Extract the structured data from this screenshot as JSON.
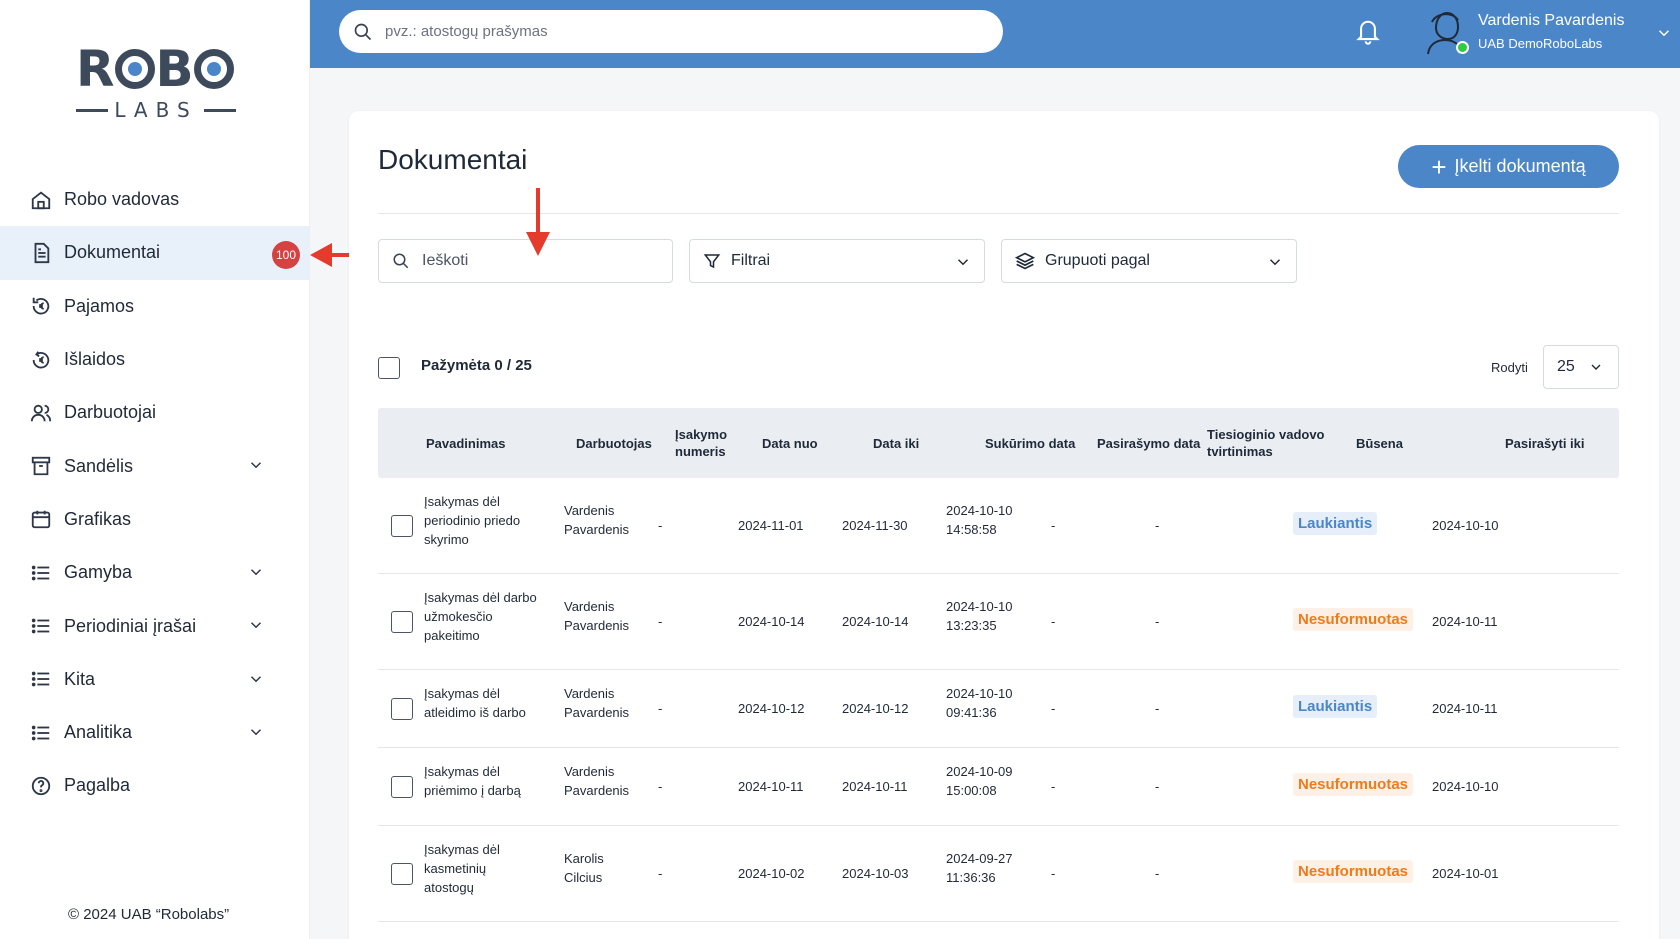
{
  "colors": {
    "primary": "#4a86c8",
    "badge": "#d64242",
    "waiting": "#4a86c8",
    "unformed": "#ee7c1a",
    "annotation_arrow": "#e53b2c"
  },
  "logo": {
    "text_top": "ROBO",
    "text_bottom": "LABS"
  },
  "sidebar": {
    "items": [
      {
        "label": "Robo vadovas",
        "icon": "home-icon"
      },
      {
        "label": "Dokumentai",
        "icon": "document-icon",
        "badge": "100",
        "active": true
      },
      {
        "label": "Pajamos",
        "icon": "euro-in-icon"
      },
      {
        "label": "Išlaidos",
        "icon": "euro-out-icon"
      },
      {
        "label": "Darbuotojai",
        "icon": "users-icon"
      },
      {
        "label": "Sandėlis",
        "icon": "archive-icon",
        "expandable": true
      },
      {
        "label": "Grafikas",
        "icon": "calendar-icon"
      },
      {
        "label": "Gamyba",
        "icon": "list-icon",
        "expandable": true
      },
      {
        "label": "Periodiniai įrašai",
        "icon": "list-icon",
        "expandable": true
      },
      {
        "label": "Kita",
        "icon": "list-icon",
        "expandable": true
      },
      {
        "label": "Analitika",
        "icon": "list-icon",
        "expandable": true
      },
      {
        "label": "Pagalba",
        "icon": "help-icon"
      }
    ],
    "copyright": "© 2024 UAB “Robolabs”"
  },
  "topbar": {
    "search_placeholder": "pvz.: atostogų prašymas",
    "user_name": "Vardenis Pavardenis",
    "user_company": "UAB DemoRoboLabs"
  },
  "main": {
    "title": "Dokumentai",
    "upload_label": "Įkelti dokumentą",
    "search_placeholder": "Ieškoti",
    "filters_label": "Filtrai",
    "group_label": "Grupuoti pagal",
    "selected_text": "Pažymėta 0 / 25",
    "show_label": "Rodyti",
    "page_size": "25"
  },
  "table": {
    "headers": {
      "name": "Pavadinimas",
      "employee": "Darbuotojas",
      "order_no_1": "Įsakymo",
      "order_no_2": "numeris",
      "date_from": "Data nuo",
      "date_to": "Data iki",
      "created": "Sukūrimo data",
      "signed": "Pasirašymo data",
      "manager_1": "Tiesioginio vadovo",
      "manager_2": "tvirtinimas",
      "status": "Būsena",
      "sign_until": "Pasirašyti iki"
    },
    "rows": [
      {
        "name": [
          "Įsakymas dėl",
          "periodinio priedo",
          "skyrimo"
        ],
        "employee": [
          "Vardenis",
          "Pavardenis"
        ],
        "order_no": "-",
        "date_from": "2024-11-01",
        "date_to": "2024-11-30",
        "created": [
          "2024-10-10",
          "14:58:58"
        ],
        "signed": "-",
        "manager": "-",
        "status": "Laukiantis",
        "status_type": "waiting",
        "sign_until": "2024-10-10"
      },
      {
        "name": [
          "Įsakymas dėl darbo",
          "užmokesčio",
          "pakeitimo"
        ],
        "employee": [
          "Vardenis",
          "Pavardenis"
        ],
        "order_no": "-",
        "date_from": "2024-10-14",
        "date_to": "2024-10-14",
        "created": [
          "2024-10-10",
          "13:23:35"
        ],
        "signed": "-",
        "manager": "-",
        "status": "Nesuformuotas",
        "status_type": "unformed",
        "sign_until": "2024-10-11"
      },
      {
        "name": [
          "Įsakymas dėl",
          "atleidimo iš darbo"
        ],
        "employee": [
          "Vardenis",
          "Pavardenis"
        ],
        "order_no": "-",
        "date_from": "2024-10-12",
        "date_to": "2024-10-12",
        "created": [
          "2024-10-10",
          "09:41:36"
        ],
        "signed": "-",
        "manager": "-",
        "status": "Laukiantis",
        "status_type": "waiting",
        "sign_until": "2024-10-11"
      },
      {
        "name": [
          "Įsakymas dėl",
          "priėmimo į darbą"
        ],
        "employee": [
          "Vardenis",
          "Pavardenis"
        ],
        "order_no": "-",
        "date_from": "2024-10-11",
        "date_to": "2024-10-11",
        "created": [
          "2024-10-09",
          "15:00:08"
        ],
        "signed": "-",
        "manager": "-",
        "status": "Nesuformuotas",
        "status_type": "unformed",
        "sign_until": "2024-10-10"
      },
      {
        "name": [
          "Įsakymas dėl",
          "kasmetinių",
          "atostogų"
        ],
        "employee": [
          "Karolis",
          "Cilcius"
        ],
        "order_no": "-",
        "date_from": "2024-10-02",
        "date_to": "2024-10-03",
        "created": [
          "2024-09-27",
          "11:36:36"
        ],
        "signed": "-",
        "manager": "-",
        "status": "Nesuformuotas",
        "status_type": "unformed",
        "sign_until": "2024-10-01"
      }
    ]
  }
}
